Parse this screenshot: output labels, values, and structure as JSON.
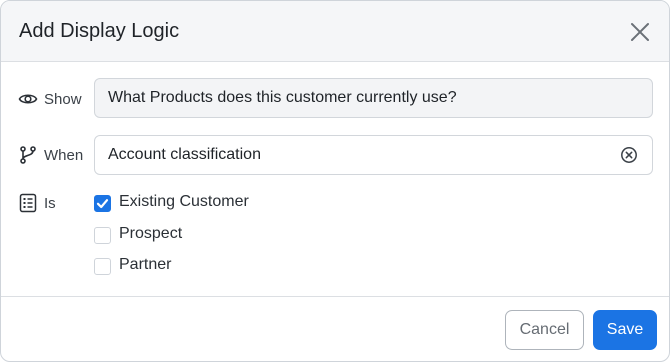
{
  "dialog": {
    "title": "Add Display Logic",
    "close_icon": "close-icon"
  },
  "rows": {
    "show": {
      "icon": "eye-icon",
      "label": "Show",
      "value": "What Products does this customer currently use?"
    },
    "when": {
      "icon": "branch-icon",
      "label": "When",
      "value": "Account classification",
      "clear_icon": "clear-circle-icon"
    },
    "is": {
      "icon": "checklist-icon",
      "label": "Is",
      "options": [
        {
          "label": "Existing Customer",
          "checked": true
        },
        {
          "label": "Prospect",
          "checked": false
        },
        {
          "label": "Partner",
          "checked": false
        }
      ]
    }
  },
  "footer": {
    "cancel_label": "Cancel",
    "save_label": "Save"
  },
  "colors": {
    "accent": "#1b74e4",
    "header_bg": "#f5f6f8",
    "border": "#d2d6db"
  }
}
